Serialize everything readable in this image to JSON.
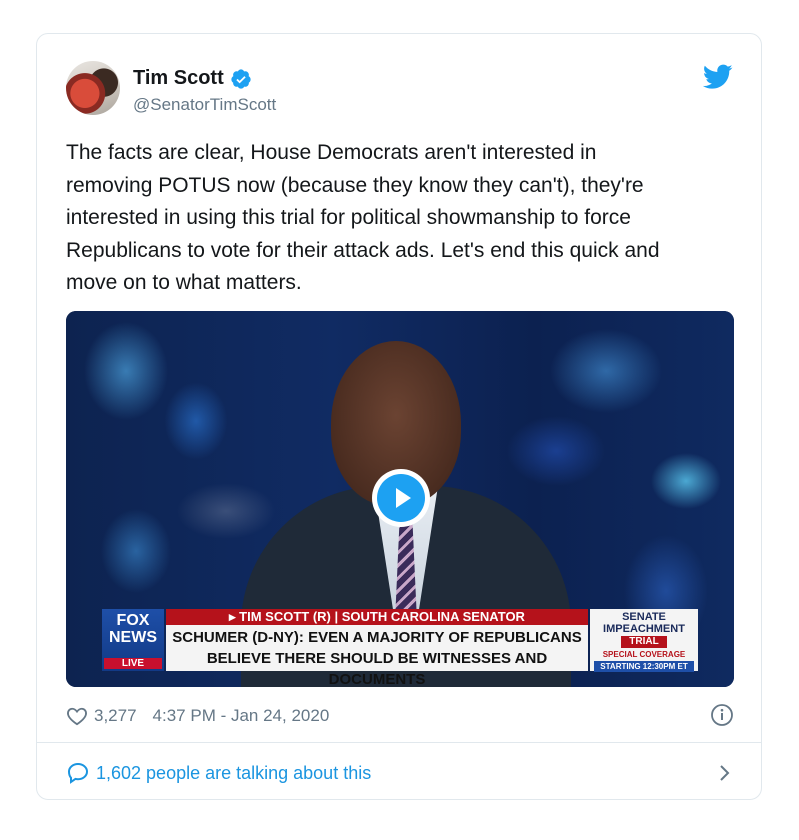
{
  "author": {
    "name": "Tim Scott",
    "handle": "@SenatorTimScott",
    "verified": true
  },
  "tweet": {
    "lines": [
      "The facts are clear, House Democrats aren't interested in",
      "removing POTUS now (because they know they can't), they're",
      "interested in using this trial for political showmanship to force",
      "Republicans to vote for their attack ads. Let's end this quick and",
      "move on to what matters."
    ]
  },
  "media": {
    "type": "video",
    "lower_third": {
      "network_line1": "FOX",
      "network_line2": "NEWS",
      "network_badge": "LIVE",
      "name_bar": "▸ TIM SCOTT (R) | SOUTH CAROLINA SENATOR",
      "headline_line1": "SCHUMER (D-NY): EVEN A MAJORITY OF REPUBLICANS",
      "headline_line2": "BELIEVE THERE SHOULD BE WITNESSES AND DOCUMENTS",
      "side_line1": "SENATE",
      "side_line2": "IMPEACHMENT",
      "side_badge": "TRIAL",
      "side_line3": "SPECIAL COVERAGE",
      "side_time": "STARTING 12:30PM ET"
    }
  },
  "meta": {
    "likes": "3,277",
    "timestamp": "4:37 PM - Jan 24, 2020"
  },
  "footer": {
    "talking": "1,602 people are talking about this"
  },
  "colors": {
    "accent": "#1da1f2",
    "link": "#1b95e0",
    "muted": "#657786",
    "border": "#e1e8ed"
  },
  "icons": [
    "verified-badge-icon",
    "twitter-bird-icon",
    "play-icon",
    "heart-icon",
    "info-icon",
    "speech-bubble-icon",
    "chevron-right-icon"
  ]
}
